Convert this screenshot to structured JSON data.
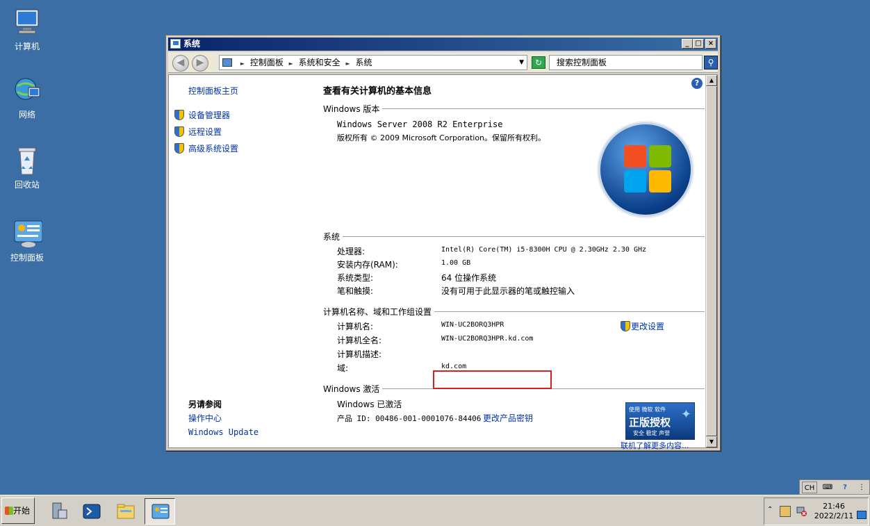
{
  "desktop": {
    "icons": [
      {
        "label": "计算机",
        "icon": "computer-icon"
      },
      {
        "label": "网络",
        "icon": "network-icon"
      },
      {
        "label": "回收站",
        "icon": "recycle-bin-icon"
      },
      {
        "label": "控制面板",
        "icon": "control-panel-icon"
      }
    ],
    "background": "#3a6ea5"
  },
  "window": {
    "title": "系统",
    "controls": {
      "minimize": "_",
      "maximize": "□",
      "close": "×"
    },
    "address": {
      "crumbs": [
        "控制面板",
        "系统和安全",
        "系统"
      ],
      "search_placeholder": "搜索控制面板"
    },
    "left_pane": {
      "home_link": "控制面板主页",
      "tasks": [
        "设备管理器",
        "远程设置",
        "高级系统设置"
      ],
      "see_also_title": "另请参阅",
      "see_also": [
        "操作中心",
        "Windows Update"
      ]
    },
    "main": {
      "heading": "查看有关计算机的基本信息",
      "edition": {
        "section": "Windows 版本",
        "name": "Windows Server 2008 R2 Enterprise",
        "copyright": "版权所有 © 2009 Microsoft Corporation。保留所有权利。"
      },
      "system": {
        "section": "系统",
        "rows": [
          {
            "label": "处理器:",
            "value": "Intel(R) Core(TM) i5-8300H CPU @ 2.30GHz   2.30 GHz"
          },
          {
            "label": "安装内存(RAM):",
            "value": "1.00 GB"
          },
          {
            "label": "系统类型:",
            "value": "64 位操作系统"
          },
          {
            "label": "笔和触摸:",
            "value": "没有可用于此显示器的笔或触控输入"
          }
        ]
      },
      "computer_name": {
        "section": "计算机名称、域和工作组设置",
        "change_link": "更改设置",
        "rows": [
          {
            "label": "计算机名:",
            "value": "WIN-UC2BORQ3HPR"
          },
          {
            "label": "计算机全名:",
            "value": "WIN-UC2BORQ3HPR.kd.com"
          },
          {
            "label": "计算机描述:",
            "value": ""
          },
          {
            "label": "域:",
            "value": "kd.com"
          }
        ]
      },
      "activation": {
        "section": "Windows 激活",
        "status": "Windows 已激活",
        "product_id": "产品 ID: 00486-001-0001076-84406",
        "change_key_link": "更改产品密钥",
        "genuine_top": "使用 微软 软件",
        "genuine_main": "正版授权",
        "genuine_sub": "安全 稳定 声誉",
        "learn_more": "联机了解更多内容..."
      }
    }
  },
  "langbar": {
    "lang": "CH"
  },
  "taskbar": {
    "start_label": "开始",
    "clock_time": "21:46",
    "clock_date": "2022/2/11"
  },
  "colors": {
    "link": "#0033aa",
    "highlight_box": "#d92020",
    "title_bar": "#0a246a"
  }
}
